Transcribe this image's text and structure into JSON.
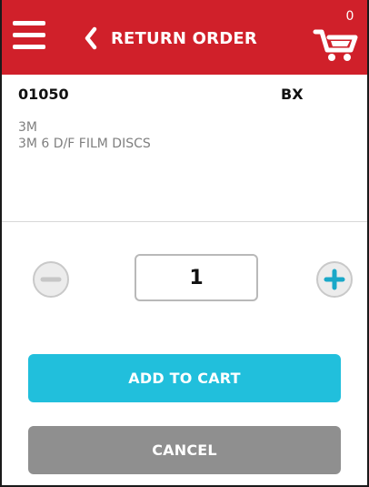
{
  "header": {
    "title": "RETURN ORDER",
    "cart_count": "0"
  },
  "product": {
    "sku": "01050",
    "unit": "BX",
    "brand": "3M",
    "description": "3M 6 D/F FILM DISCS"
  },
  "quantity": {
    "value": "1"
  },
  "actions": {
    "add_to_cart": "ADD TO CART",
    "cancel": "CANCEL"
  },
  "colors": {
    "header_bg": "#d0202a",
    "primary": "#21bfdc",
    "secondary": "#8f8f8f"
  },
  "icons": {
    "menu": "menu-icon",
    "back": "chevron-left-icon",
    "cart": "cart-icon",
    "decrement": "minus-icon",
    "increment": "plus-icon"
  }
}
